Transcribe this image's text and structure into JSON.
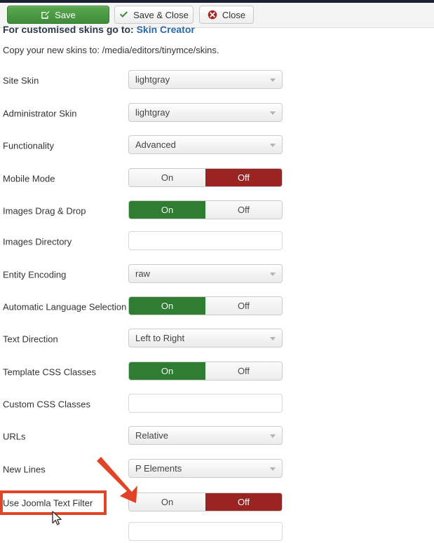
{
  "toolbar": {
    "save_label": "Save",
    "save_close_label": "Save & Close",
    "close_label": "Close"
  },
  "notes": {
    "heading_prefix": "For customised skins go to: ",
    "heading_link": "Skin Creator",
    "subtext": "Copy your new skins to: /media/editors/tinymce/skins."
  },
  "toggle_labels": {
    "on": "On",
    "off": "Off"
  },
  "colors": {
    "save_green": "#3f8b3a",
    "toggle_on_green": "#2e7d32",
    "toggle_off_red": "#9b2423",
    "annotation_red": "#e04426",
    "link_blue": "#2b6aa8",
    "toolbar_bg": "#f4f4f4",
    "top_strip": "#1b2130"
  },
  "form": {
    "rows": [
      {
        "label": "Site Skin",
        "type": "select",
        "value": "lightgray",
        "name": "site-skin"
      },
      {
        "label": "Administrator Skin",
        "type": "select",
        "value": "lightgray",
        "name": "administrator-skin"
      },
      {
        "label": "Functionality",
        "type": "select",
        "value": "Advanced",
        "name": "functionality"
      },
      {
        "label": "Mobile Mode",
        "type": "toggle",
        "value": "Off",
        "name": "mobile-mode"
      },
      {
        "label": "Images Drag & Drop",
        "type": "toggle",
        "value": "On",
        "name": "images-drag-and-drop"
      },
      {
        "label": "Images Directory",
        "type": "text",
        "value": "",
        "name": "images-directory"
      },
      {
        "label": "Entity Encoding",
        "type": "select",
        "value": "raw",
        "name": "entity-encoding"
      },
      {
        "label": "Automatic Language Selection",
        "type": "toggle",
        "value": "On",
        "name": "automatic-language-selection"
      },
      {
        "label": "Text Direction",
        "type": "select",
        "value": "Left to Right",
        "name": "text-direction"
      },
      {
        "label": "Template CSS Classes",
        "type": "toggle",
        "value": "On",
        "name": "template-css-classes"
      },
      {
        "label": "Custom CSS Classes",
        "type": "text",
        "value": "",
        "name": "custom-css-classes"
      },
      {
        "label": "URLs",
        "type": "select",
        "value": "Relative",
        "name": "urls"
      },
      {
        "label": "New Lines",
        "type": "select",
        "value": "P Elements",
        "name": "new-lines"
      },
      {
        "label": "Use Joomla Text Filter",
        "type": "toggle",
        "value": "Off",
        "name": "use-joomla-text-filter"
      },
      {
        "label": "",
        "type": "text",
        "value": "",
        "name": "partial-field-below"
      }
    ]
  }
}
